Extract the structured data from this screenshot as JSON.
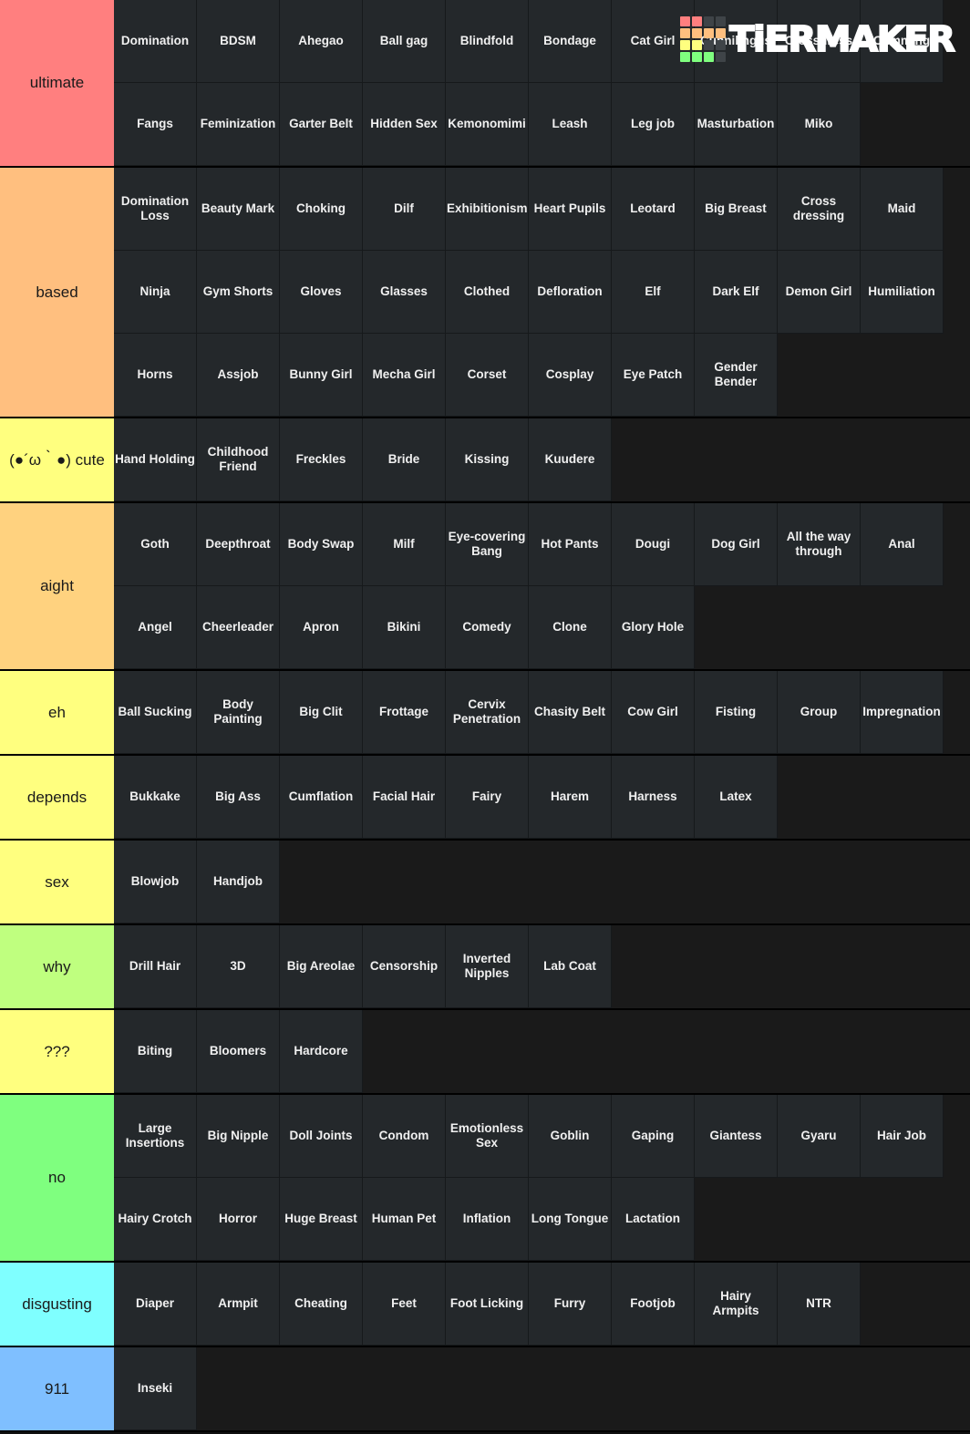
{
  "watermark": {
    "brand": "TiERMAKER",
    "swatches": [
      "#ff7f7f",
      "#ff7f7f",
      "#3f4448",
      "#3f4448",
      "#ffbf7f",
      "#ffbf7f",
      "#ffbf7f",
      "#ffbf7f",
      "#ffff7f",
      "#ffff7f",
      "#3f4448",
      "#3f4448",
      "#7fff7f",
      "#7fff7f",
      "#7fff7f",
      "#3f4448"
    ]
  },
  "tiers": [
    {
      "label": "ultimate",
      "color": "#ff7f7f",
      "items": [
        "Domination",
        "BDSM",
        "Ahegao",
        "Ball gag",
        "Blindfold",
        "Bondage",
        "Cat Girl",
        "Cunnilingus",
        "Crossdress",
        "Cumming",
        "Fangs",
        "Feminization",
        "Garter Belt",
        "Hidden Sex",
        "Kemonomimi",
        "Leash",
        "Leg job",
        "Masturbation",
        "Miko"
      ]
    },
    {
      "label": "based",
      "color": "#ffbf7f",
      "items": [
        "Domination Loss",
        "Beauty Mark",
        "Choking",
        "Dilf",
        "Exhibitionism",
        "Heart Pupils",
        "Leotard",
        "Big Breast",
        "Cross dressing",
        "Maid",
        "Ninja",
        "Gym Shorts",
        "Gloves",
        "Glasses",
        "Clothed",
        "Defloration",
        "Elf",
        "Dark Elf",
        "Demon Girl",
        "Humiliation",
        "Horns",
        "Assjob",
        "Bunny Girl",
        "Mecha Girl",
        "Corset",
        "Cosplay",
        "Eye Patch",
        "Gender Bender"
      ]
    },
    {
      "label": "(●´ω｀●) cute",
      "color": "#ffff7f",
      "items": [
        "Hand Holding",
        "Childhood Friend",
        "Freckles",
        "Bride",
        "Kissing",
        "Kuudere"
      ]
    },
    {
      "label": "aight",
      "color": "#ffd27f",
      "items": [
        "Goth",
        "Deepthroat",
        "Body Swap",
        "Milf",
        "Eye-covering Bang",
        "Hot Pants",
        "Dougi",
        "Dog Girl",
        "All the way through",
        "Anal",
        "Angel",
        "Cheerleader",
        "Apron",
        "Bikini",
        "Comedy",
        "Clone",
        "Glory Hole"
      ]
    },
    {
      "label": "eh",
      "color": "#ffff7f",
      "items": [
        "Ball Sucking",
        "Body Painting",
        "Big Clit",
        "Frottage",
        "Cervix Penetration",
        "Chasity Belt",
        "Cow Girl",
        "Fisting",
        "Group",
        "Impregnation"
      ]
    },
    {
      "label": "depends",
      "color": "#ffff7f",
      "items": [
        "Bukkake",
        "Big Ass",
        "Cumflation",
        "Facial Hair",
        "Fairy",
        "Harem",
        "Harness",
        "Latex"
      ]
    },
    {
      "label": "sex",
      "color": "#ffff7f",
      "items": [
        "Blowjob",
        "Handjob"
      ]
    },
    {
      "label": "why",
      "color": "#bfff7f",
      "items": [
        "Drill Hair",
        "3D",
        "Big Areolae",
        "Censorship",
        "Inverted Nipples",
        "Lab Coat"
      ]
    },
    {
      "label": "???",
      "color": "#ffff7f",
      "items": [
        "Biting",
        "Bloomers",
        "Hardcore"
      ]
    },
    {
      "label": "no",
      "color": "#7fff7f",
      "items": [
        "Large Insertions",
        "Big Nipple",
        "Doll Joints",
        "Condom",
        "Emotionless Sex",
        "Goblin",
        "Gaping",
        "Giantess",
        "Gyaru",
        "Hair Job",
        "Hairy Crotch",
        "Horror",
        "Huge Breast",
        "Human Pet",
        "Inflation",
        "Long Tongue",
        "Lactation"
      ]
    },
    {
      "label": "disgusting",
      "color": "#7fffff",
      "items": [
        "Diaper",
        "Armpit",
        "Cheating",
        "Feet",
        "Foot Licking",
        "Furry",
        "Footjob",
        "Hairy Armpits",
        "NTR"
      ]
    },
    {
      "label": "911",
      "color": "#7fbfff",
      "items": [
        "Inseki"
      ]
    }
  ]
}
